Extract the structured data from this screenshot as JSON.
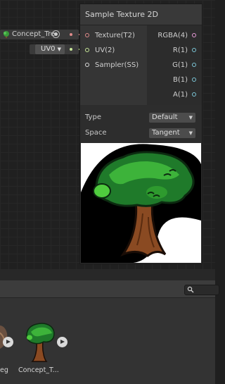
{
  "graph": {
    "texture_property": {
      "name": "Concept_Tre"
    },
    "uv_property": {
      "value": "UV0"
    }
  },
  "node": {
    "title": "Sample Texture 2D",
    "inputs": [
      {
        "label": "Texture(T2)",
        "color": "#e08b8b"
      },
      {
        "label": "UV(2)",
        "color": "#c8e89a"
      },
      {
        "label": "Sampler(SS)",
        "color": "#dcdcdc"
      }
    ],
    "outputs": [
      {
        "label": "RGBA(4)",
        "color": "#e79ad8"
      },
      {
        "label": "R(1)",
        "color": "#7cc7d8"
      },
      {
        "label": "G(1)",
        "color": "#7cc7d8"
      },
      {
        "label": "B(1)",
        "color": "#7cc7d8"
      },
      {
        "label": "A(1)",
        "color": "#7cc7d8"
      }
    ],
    "settings": {
      "type_label": "Type",
      "type_value": "Default",
      "space_label": "Space",
      "space_value": "Tangent"
    },
    "preview_icon": "tree-texture-preview"
  },
  "project_panel": {
    "search_icon": "search-icon",
    "assets": [
      {
        "label": "eg",
        "icon": "texture-thumbnail"
      },
      {
        "label": "Concept_T...",
        "icon": "tree-thumbnail"
      }
    ]
  }
}
